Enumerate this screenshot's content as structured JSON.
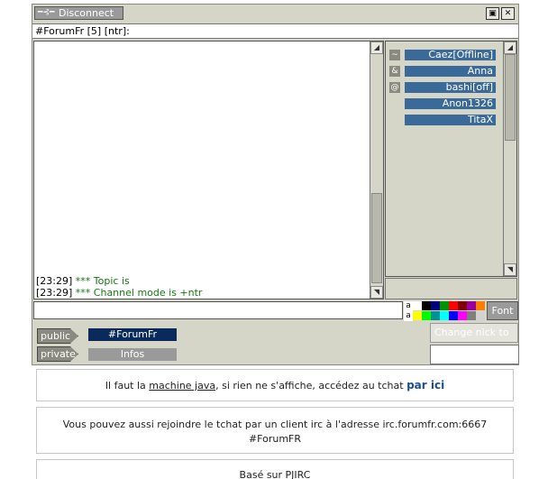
{
  "topbar": {
    "disconnect_label": "Disconnect",
    "restore_glyph": "▣",
    "close_glyph": "✕"
  },
  "channel_header": {
    "title": "#ForumFr [5] [ntr]:"
  },
  "chat": {
    "lines": [
      {
        "time": "[23:29]",
        "text": "*** Topic is"
      },
      {
        "time": "[23:29]",
        "text": "*** Channel mode is +ntr"
      }
    ]
  },
  "nicklist": {
    "users": [
      {
        "mode": "~",
        "name": "Caez[Offline]"
      },
      {
        "mode": "&",
        "name": "Anna"
      },
      {
        "mode": "@",
        "name": "bashi[off]"
      },
      {
        "mode": "",
        "name": "Anon1326"
      },
      {
        "mode": "",
        "name": "TitaX"
      }
    ]
  },
  "input": {
    "value": ""
  },
  "palette": {
    "row1_label": "a",
    "row2_label": "a",
    "row1": [
      "#ffffff",
      "#000000",
      "#00007f",
      "#009300",
      "#ff0000",
      "#7f0000",
      "#9c009c",
      "#fc7f00"
    ],
    "row2": [
      "#ffff00",
      "#00fc00",
      "#009393",
      "#00ffff",
      "#0000fc",
      "#ff00ff",
      "#7f7f7f",
      "#d2d2d2"
    ]
  },
  "font_button": {
    "label": "Font"
  },
  "tabs": {
    "public_label": "public",
    "private_label": "private",
    "public_items": [
      "#ForumFr"
    ],
    "private_items": [
      "Infos"
    ],
    "public_active_color": "#0a2a5c",
    "private_color": "#9a9a9a"
  },
  "nick_change": {
    "label": "Change nick to",
    "value": ""
  },
  "info": {
    "java_prefix": "Il faut la ",
    "java_link": "machine java",
    "java_middle": ", si rien ne s'affiche, accédez au tchat ",
    "java_here": "par ici",
    "irc_line1": "Vous pouvez aussi rejoindre le tchat par un client irc à l'adresse irc.forumfr.com:6667",
    "irc_line2": "#ForumFR",
    "based_on": "Basé sur PJIRC"
  }
}
